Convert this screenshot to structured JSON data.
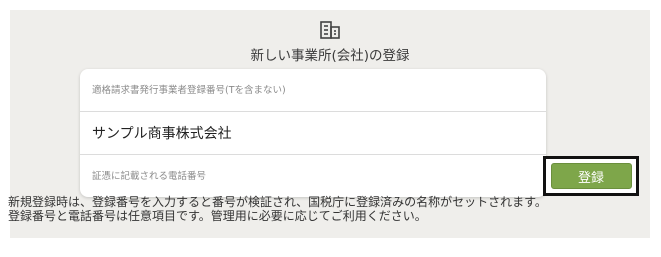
{
  "header": {
    "icon": "building-icon",
    "title": "新しい事業所(会社)の登録"
  },
  "form": {
    "registration_number_placeholder": "適格請求書発行事業者登録番号(Tを含まない)",
    "registration_number_value": "",
    "company_name_value": "サンプル商事株式会社",
    "phone_placeholder": "証憑に記載される電話番号",
    "phone_value": ""
  },
  "actions": {
    "register_label": "登録",
    "accent_color": "#7ea64a"
  },
  "help": {
    "line1": "新規登録時は、登録番号を入力すると番号が検証され、国税庁に登録済みの名称がセットされます。",
    "line2": "登録番号と電話番号は任意項目です。管理用に必要に応じてご利用ください。"
  }
}
